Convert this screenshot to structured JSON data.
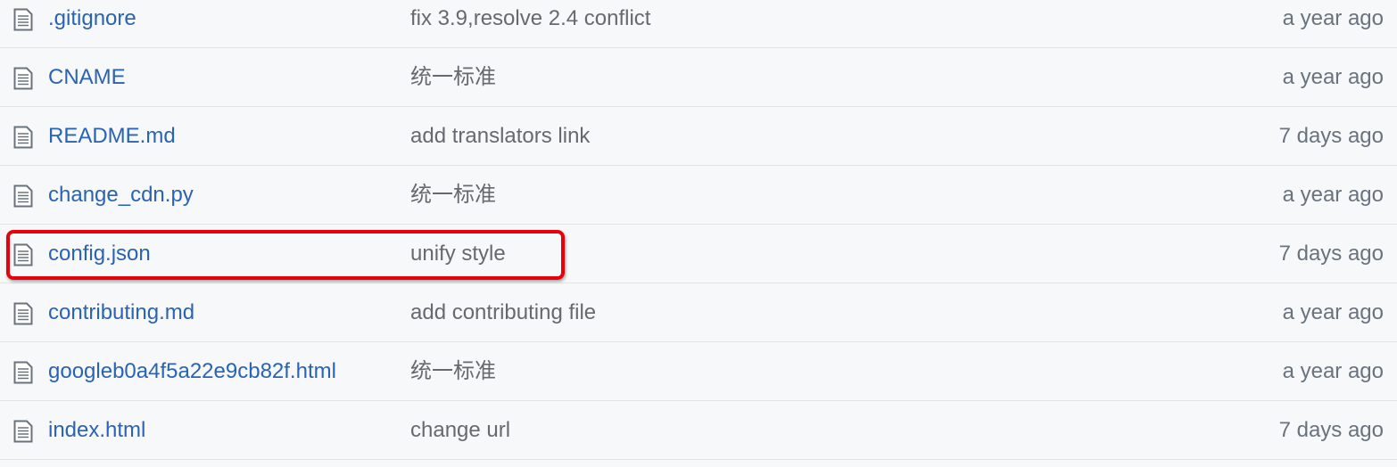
{
  "files": [
    {
      "name": ".gitignore",
      "message": "fix 3.9,resolve 2.4 conflict",
      "age": "a year ago",
      "icon": "file-text-icon"
    },
    {
      "name": "CNAME",
      "message": "统一标准",
      "age": "a year ago",
      "icon": "file-text-icon"
    },
    {
      "name": "README.md",
      "message": "add translators link",
      "age": "7 days ago",
      "icon": "file-text-icon"
    },
    {
      "name": "change_cdn.py",
      "message": "统一标准",
      "age": "a year ago",
      "icon": "file-text-icon"
    },
    {
      "name": "config.json",
      "message": "unify style",
      "age": "7 days ago",
      "icon": "file-text-icon"
    },
    {
      "name": "contributing.md",
      "message": "add contributing file",
      "age": "a year ago",
      "icon": "file-text-icon"
    },
    {
      "name": "googleb0a4f5a22e9cb82f.html",
      "message": "统一标准",
      "age": "a year ago",
      "icon": "file-text-icon"
    },
    {
      "name": "index.html",
      "message": "change url",
      "age": "7 days ago",
      "icon": "file-text-icon"
    }
  ],
  "colors": {
    "link": "#2a63b3",
    "message": "#666a6e",
    "highlight": "#e8000b",
    "background": "#f6f8fa"
  }
}
